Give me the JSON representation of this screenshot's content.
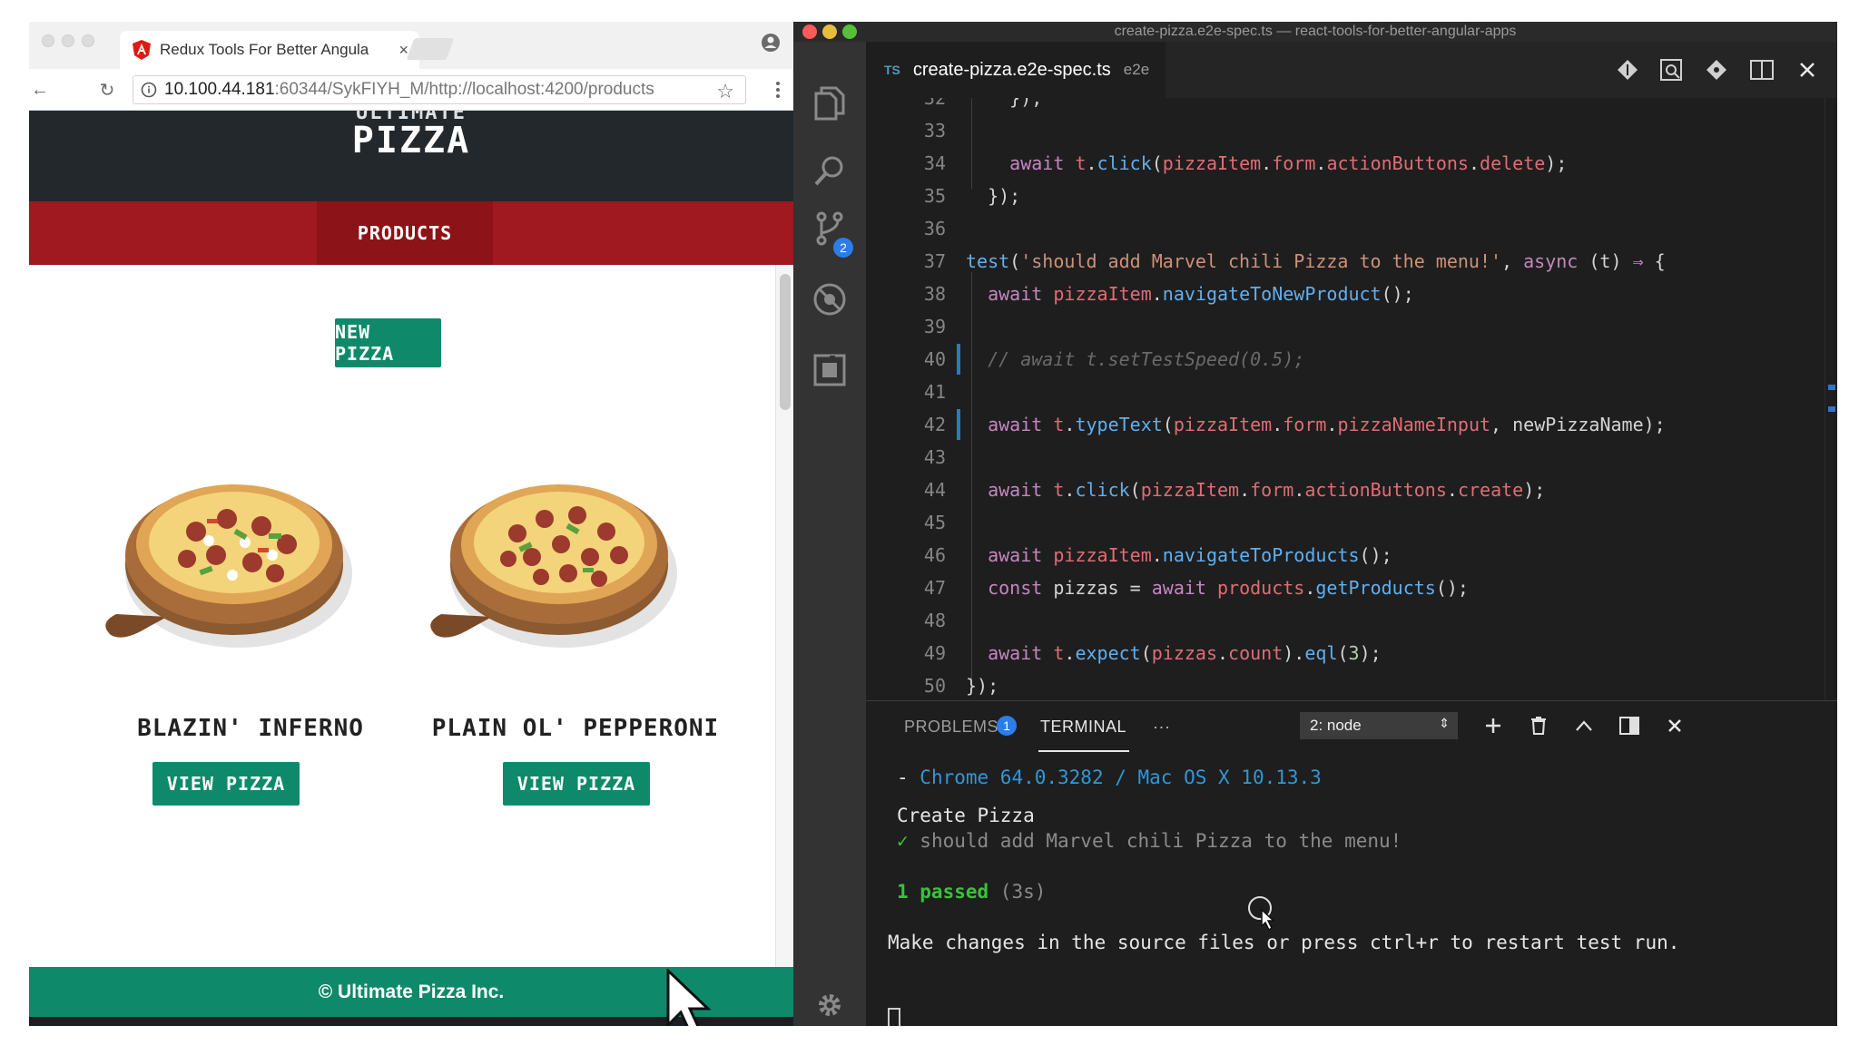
{
  "browser": {
    "tab_title": "Redux Tools For Better Angula",
    "tab_close": "×",
    "url_host": "10.100.44.181",
    "url_rest": ":60344/SykFIYH_M/http://localhost:4200/products",
    "star": "☆",
    "back": "←",
    "reload": "↻"
  },
  "site": {
    "title_top": "ULTIMATE",
    "title": "PIZZA",
    "nav_products": "PRODUCTS",
    "new_pizza": "NEW PIZZA",
    "pizzas": [
      {
        "name": "BLAZIN' INFERNO",
        "button": "VIEW PIZZA"
      },
      {
        "name": "PLAIN OL' PEPPERONI",
        "button": "VIEW PIZZA"
      }
    ],
    "footer": "© Ultimate Pizza Inc."
  },
  "vscode": {
    "window_title": "create-pizza.e2e-spec.ts — react-tools-for-better-angular-apps",
    "tab_lang": "TS",
    "tab_file": "create-pizza.e2e-spec.ts",
    "tab_desc": "e2e",
    "scm_badge": "2",
    "code_lines": [
      {
        "n": "32",
        "tokens": [
          {
            "t": "    });",
            "c": "k-plain"
          }
        ]
      },
      {
        "n": "33",
        "tokens": []
      },
      {
        "n": "34",
        "tokens": [
          {
            "t": "    ",
            "c": "k-plain"
          },
          {
            "t": "await",
            "c": "k-kw"
          },
          {
            "t": " ",
            "c": "k-plain"
          },
          {
            "t": "t",
            "c": "k-var"
          },
          {
            "t": ".",
            "c": "k-plain"
          },
          {
            "t": "click",
            "c": "k-fn"
          },
          {
            "t": "(",
            "c": "k-plain"
          },
          {
            "t": "pizzaItem",
            "c": "k-var"
          },
          {
            "t": ".",
            "c": "k-plain"
          },
          {
            "t": "form",
            "c": "k-var"
          },
          {
            "t": ".",
            "c": "k-plain"
          },
          {
            "t": "actionButtons",
            "c": "k-var"
          },
          {
            "t": ".",
            "c": "k-plain"
          },
          {
            "t": "delete",
            "c": "k-var"
          },
          {
            "t": ");",
            "c": "k-plain"
          }
        ]
      },
      {
        "n": "35",
        "tokens": [
          {
            "t": "  });",
            "c": "k-plain"
          }
        ]
      },
      {
        "n": "36",
        "tokens": []
      },
      {
        "n": "37",
        "tokens": [
          {
            "t": "test",
            "c": "k-fn"
          },
          {
            "t": "(",
            "c": "k-plain"
          },
          {
            "t": "'should add Marvel chili Pizza to the menu!'",
            "c": "k-str"
          },
          {
            "t": ", ",
            "c": "k-plain"
          },
          {
            "t": "async",
            "c": "k-kw"
          },
          {
            "t": " (t) ",
            "c": "k-plain"
          },
          {
            "t": "⇒",
            "c": "k-kw"
          },
          {
            "t": " {",
            "c": "k-plain"
          }
        ]
      },
      {
        "n": "38",
        "tokens": [
          {
            "t": "  ",
            "c": "k-plain"
          },
          {
            "t": "await",
            "c": "k-kw"
          },
          {
            "t": " ",
            "c": "k-plain"
          },
          {
            "t": "pizzaItem",
            "c": "k-var"
          },
          {
            "t": ".",
            "c": "k-plain"
          },
          {
            "t": "navigateToNewProduct",
            "c": "k-fn"
          },
          {
            "t": "();",
            "c": "k-plain"
          }
        ]
      },
      {
        "n": "39",
        "tokens": []
      },
      {
        "n": "40",
        "tokens": [
          {
            "t": "  // await t.setTestSpeed(0.5);",
            "c": "k-cmt"
          }
        ],
        "mark": true
      },
      {
        "n": "41",
        "tokens": []
      },
      {
        "n": "42",
        "tokens": [
          {
            "t": "  ",
            "c": "k-plain"
          },
          {
            "t": "await",
            "c": "k-kw"
          },
          {
            "t": " ",
            "c": "k-plain"
          },
          {
            "t": "t",
            "c": "k-var"
          },
          {
            "t": ".",
            "c": "k-plain"
          },
          {
            "t": "typeText",
            "c": "k-fn"
          },
          {
            "t": "(",
            "c": "k-plain"
          },
          {
            "t": "pizzaItem",
            "c": "k-var"
          },
          {
            "t": ".",
            "c": "k-plain"
          },
          {
            "t": "form",
            "c": "k-var"
          },
          {
            "t": ".",
            "c": "k-plain"
          },
          {
            "t": "pizzaNameInput",
            "c": "k-var"
          },
          {
            "t": ", newPizzaName);",
            "c": "k-plain"
          }
        ],
        "mark": true
      },
      {
        "n": "43",
        "tokens": []
      },
      {
        "n": "44",
        "tokens": [
          {
            "t": "  ",
            "c": "k-plain"
          },
          {
            "t": "await",
            "c": "k-kw"
          },
          {
            "t": " ",
            "c": "k-plain"
          },
          {
            "t": "t",
            "c": "k-var"
          },
          {
            "t": ".",
            "c": "k-plain"
          },
          {
            "t": "click",
            "c": "k-fn"
          },
          {
            "t": "(",
            "c": "k-plain"
          },
          {
            "t": "pizzaItem",
            "c": "k-var"
          },
          {
            "t": ".",
            "c": "k-plain"
          },
          {
            "t": "form",
            "c": "k-var"
          },
          {
            "t": ".",
            "c": "k-plain"
          },
          {
            "t": "actionButtons",
            "c": "k-var"
          },
          {
            "t": ".",
            "c": "k-plain"
          },
          {
            "t": "create",
            "c": "k-var"
          },
          {
            "t": ");",
            "c": "k-plain"
          }
        ]
      },
      {
        "n": "45",
        "tokens": []
      },
      {
        "n": "46",
        "tokens": [
          {
            "t": "  ",
            "c": "k-plain"
          },
          {
            "t": "await",
            "c": "k-kw"
          },
          {
            "t": " ",
            "c": "k-plain"
          },
          {
            "t": "pizzaItem",
            "c": "k-var"
          },
          {
            "t": ".",
            "c": "k-plain"
          },
          {
            "t": "navigateToProducts",
            "c": "k-fn"
          },
          {
            "t": "();",
            "c": "k-plain"
          }
        ]
      },
      {
        "n": "47",
        "tokens": [
          {
            "t": "  ",
            "c": "k-plain"
          },
          {
            "t": "const",
            "c": "k-kw"
          },
          {
            "t": " pizzas = ",
            "c": "k-plain"
          },
          {
            "t": "await",
            "c": "k-kw"
          },
          {
            "t": " ",
            "c": "k-plain"
          },
          {
            "t": "products",
            "c": "k-var"
          },
          {
            "t": ".",
            "c": "k-plain"
          },
          {
            "t": "getProducts",
            "c": "k-fn"
          },
          {
            "t": "();",
            "c": "k-plain"
          }
        ]
      },
      {
        "n": "48",
        "tokens": []
      },
      {
        "n": "49",
        "tokens": [
          {
            "t": "  ",
            "c": "k-plain"
          },
          {
            "t": "await",
            "c": "k-kw"
          },
          {
            "t": " ",
            "c": "k-plain"
          },
          {
            "t": "t",
            "c": "k-var"
          },
          {
            "t": ".",
            "c": "k-plain"
          },
          {
            "t": "expect",
            "c": "k-fn"
          },
          {
            "t": "(",
            "c": "k-plain"
          },
          {
            "t": "pizzas",
            "c": "k-var"
          },
          {
            "t": ".",
            "c": "k-plain"
          },
          {
            "t": "count",
            "c": "k-var"
          },
          {
            "t": ").",
            "c": "k-plain"
          },
          {
            "t": "eql",
            "c": "k-fn"
          },
          {
            "t": "(",
            "c": "k-plain"
          },
          {
            "t": "3",
            "c": "k-num"
          },
          {
            "t": ");",
            "c": "k-plain"
          }
        ]
      },
      {
        "n": "50",
        "tokens": [
          {
            "t": "});",
            "c": "k-plain"
          }
        ]
      }
    ],
    "panel": {
      "problems_label": "PROBLEMS",
      "problems_count": "1",
      "terminal_label": "TERMINAL",
      "more": "···",
      "terminal_select": "2: node",
      "select_arrows": "⇕",
      "add": "+",
      "close": "×",
      "term_dash": "- ",
      "term_env": "Chrome 64.0.3282 / Mac OS X 10.13.3",
      "fixture": "Create Pizza",
      "check": "✓",
      "test_name": " should add Marvel chili Pizza to the menu!",
      "passed": "1 passed",
      "duration": " (3s)",
      "restart_msg": "Make changes in the source files or press ctrl+r to restart test run."
    }
  }
}
